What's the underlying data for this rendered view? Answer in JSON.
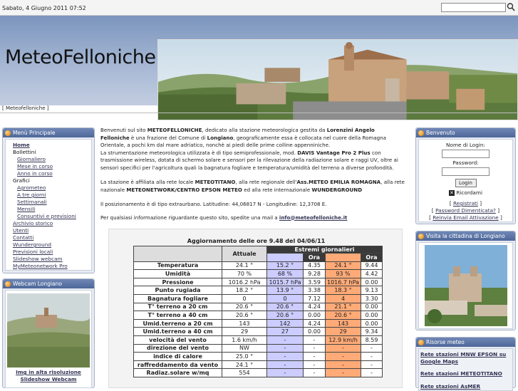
{
  "header": {
    "date": "Sabato, 4 Giugno 2011 07:52",
    "logo": "MeteoFelloniche",
    "breadcrumb": "[ Meteofelloniche ]"
  },
  "menu": {
    "title": "Menù Principale",
    "items": [
      {
        "label": "Home",
        "kind": "strong"
      },
      {
        "label": "Bollettini",
        "kind": "top"
      },
      {
        "label": "Giornaliero",
        "kind": "sub"
      },
      {
        "label": "Mese in corso",
        "kind": "sub"
      },
      {
        "label": "Anno in corso",
        "kind": "sub"
      },
      {
        "label": "Grafici",
        "kind": "top"
      },
      {
        "label": "Agrometeo",
        "kind": "sub"
      },
      {
        "label": "A tre giorni",
        "kind": "sub"
      },
      {
        "label": "Settimanali",
        "kind": "sub"
      },
      {
        "label": "Mensili",
        "kind": "sub"
      },
      {
        "label": "Consuntivi e previsioni",
        "kind": "sub"
      },
      {
        "label": "Archivio storico",
        "kind": "link"
      },
      {
        "label": "Utenti",
        "kind": "link"
      },
      {
        "label": "Contatti",
        "kind": "link"
      },
      {
        "label": "Wunderground",
        "kind": "link"
      },
      {
        "label": "Previsioni locali",
        "kind": "link"
      },
      {
        "label": "Slideshow webcam",
        "kind": "link"
      },
      {
        "label": "MyMeteonetwork Pro",
        "kind": "link"
      }
    ]
  },
  "webcam": {
    "title": "Webcam Longiano",
    "link1": "Img in alta risoluzione",
    "link2": "Slideshow Webcam"
  },
  "intro": {
    "p1a": "Benvenuti sul sito ",
    "p1b": "METEOFELLONICHE",
    "p1c": ", dedicato alla stazione meteorologica gestita da ",
    "p1d": "Lorenzini Angelo",
    "p2a": "Felloniche",
    "p2b": " è una frazione del Comune di ",
    "p2c": "Longiano",
    "p2d": ", geograficamente essa è collocata nel cuore della Romagna Orientale, a pochi km dal mare adriatico, nonchè ai piedi delle prime colline appenniniche.",
    "p3a": "La strumentazione meteorologica utilizzata è di tipo semiprofessionale, mod. ",
    "p3b": "DAVIS Vantage Pro 2 Plus",
    "p3c": " con trasmissione wireless, dotata di schermo solare e sensori per la rilevazione della radiazione solare e raggi UV, oltre ai sensori specifici per l'agricoltura quali la bagnatura fogliare e temperatura/umidità del terreno a diverse profondità.",
    "p4a": "La stazione è affiliata alla rete locale ",
    "p4b": "METEOTITANO",
    "p4c": ", alla rete regionale dell'",
    "p4d": "Ass.METEO EMILIA ROMAGNA",
    "p4e": ", alla rete nazionale ",
    "p4f": "METEONETWORK/CENTRO EPSON METEO",
    "p4g": " ed alla rete internazionale ",
    "p4h": "WUNDERGROUND",
    "p5": "Il posizionamento è di tipo extraurbano. Latitudine: 44,06817 N - Longitudine: 12,3708 E.",
    "p6a": "Per qualsiasi informazione riguardante questo sito, spedite una mail a ",
    "p6b": "info@meteofelloniche.it"
  },
  "weather": {
    "title": "Aggiornamento delle ore 9.48 del 04/06/11",
    "col_current": "Attuale",
    "col_extremes": "Estremi giornalieri",
    "col_time": "Ora",
    "rows": [
      [
        "Temperatura",
        "24.1 °",
        "15.2 °",
        "4.35",
        "24.1 °",
        "9.44"
      ],
      [
        "Umidità",
        "70 %",
        "68 %",
        "9.28",
        "93 %",
        "4.42"
      ],
      [
        "Pressione",
        "1016.2 hPa",
        "1015.7 hPa",
        "3.59",
        "1016.7 hPa",
        "0.00"
      ],
      [
        "Punto rugiada",
        "18.2 °",
        "13.9 °",
        "3.38",
        "18.3 °",
        "9.13"
      ],
      [
        "Bagnatura fogliare",
        "0",
        "0",
        "7.12",
        "4",
        "3.30"
      ],
      [
        "T° terreno a 20 cm",
        "20.6 °",
        "20.6 °",
        "4.24",
        "21.1 °",
        "0.00"
      ],
      [
        "T° terreno a 40 cm",
        "20.6 °",
        "20.6 °",
        "0.00",
        "20.6 °",
        "0.00"
      ],
      [
        "Umid.terreno a 20 cm",
        "143",
        "142",
        "4.24",
        "143",
        "0.00"
      ],
      [
        "Umid.terreno a 40 cm",
        "29",
        "27",
        "0.00",
        "29",
        "9.34"
      ],
      [
        "velocità del vento",
        "1.6 km/h",
        "-",
        "-",
        "12.9 km/h",
        "8.59"
      ],
      [
        "direzione del vento",
        "NW",
        "-",
        "-",
        "-",
        "-"
      ],
      [
        "indice di calore",
        "25.0 °",
        "-",
        "-",
        "-",
        "-"
      ],
      [
        "raffreddamento da vento",
        "24.1 °",
        "-",
        "-",
        "-",
        "-"
      ],
      [
        "Radiaz.solare w/mq",
        "554",
        "-",
        "-",
        "-",
        "-"
      ]
    ]
  },
  "login": {
    "title": "Benvenuto",
    "user_label": "Nome di Login:",
    "pass_label": "Password:",
    "button": "Login",
    "remember": "Ricordami",
    "register": "Registrati",
    "forgot": "Password Dimenticata?",
    "resend": "Reinvia Email Attivazione"
  },
  "visit": {
    "title": "Visita la cittadina di Longiano"
  },
  "resources": {
    "title": "Risorse meteo",
    "link1": "Rete stazioni MNW EPSON su Google Maps",
    "link2": "Rete stazioni METEOTITANO",
    "link3": "Rete stazioni AsMER"
  }
}
